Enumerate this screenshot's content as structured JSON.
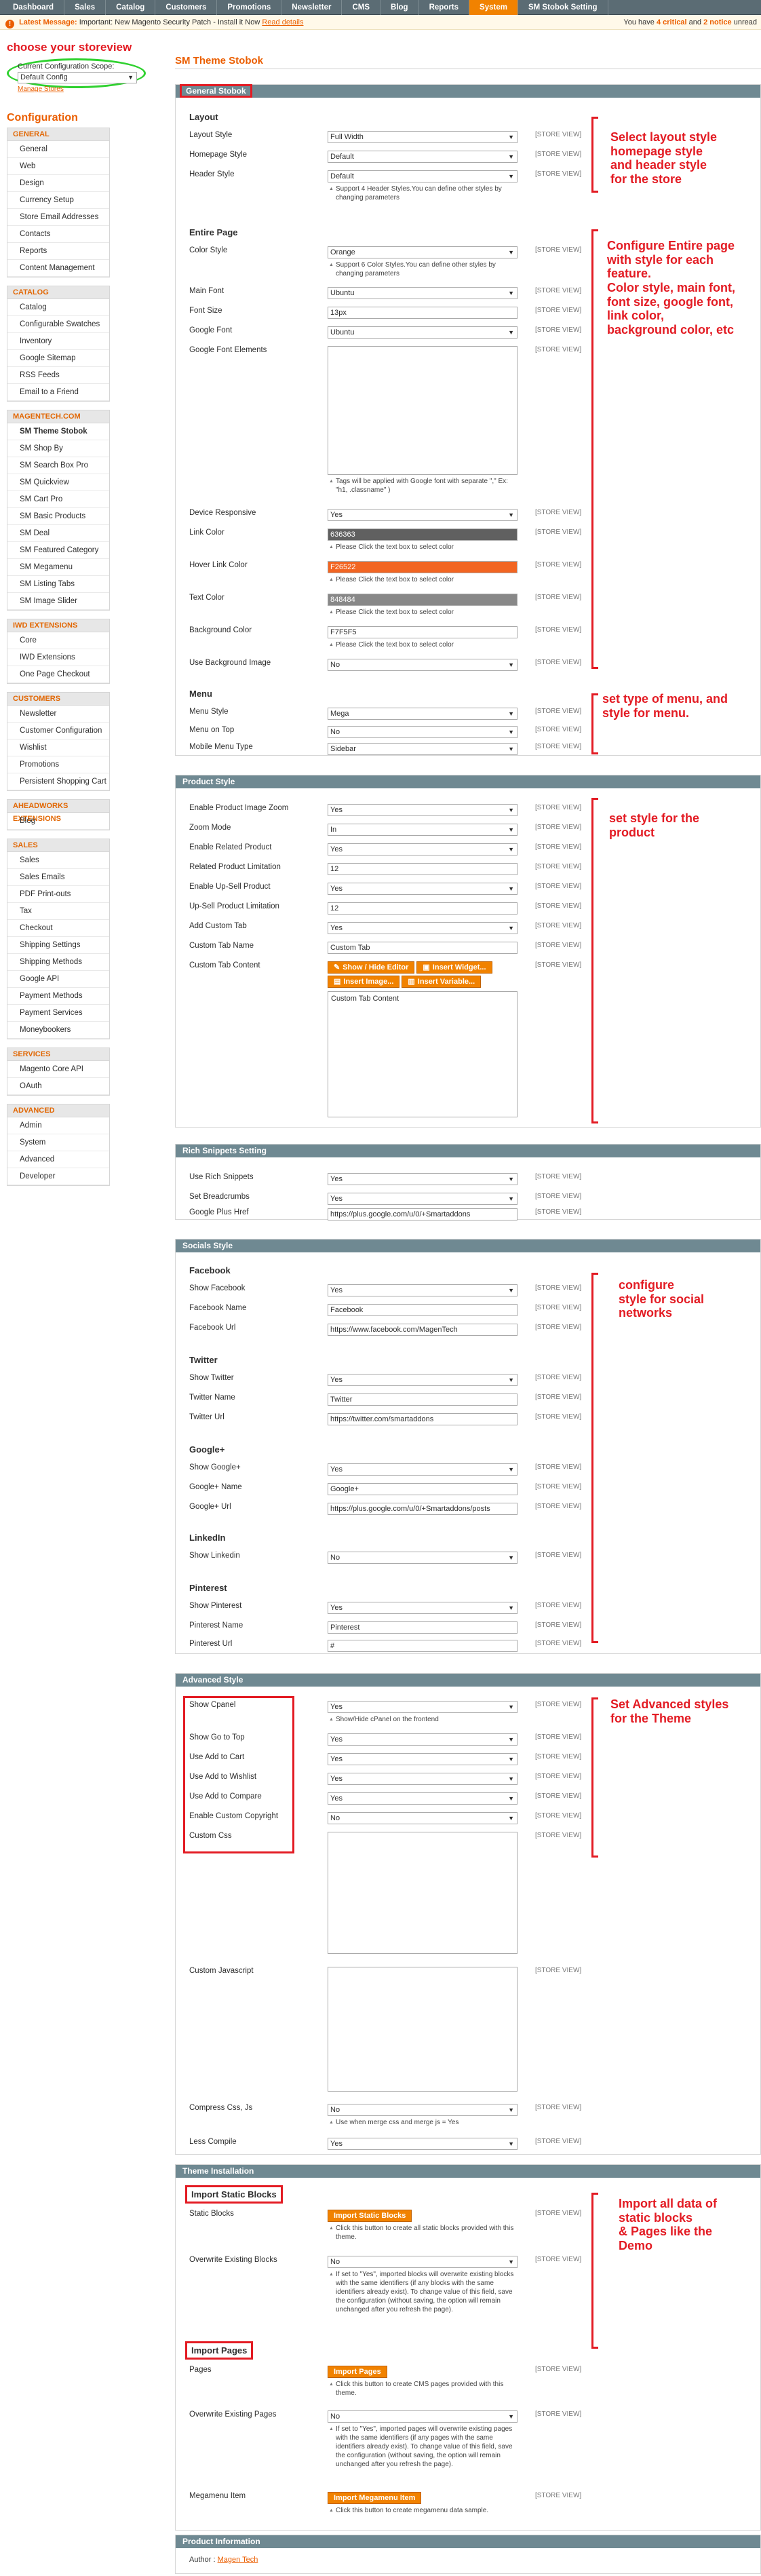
{
  "nav": [
    "Dashboard",
    "Sales",
    "Catalog",
    "Customers",
    "Promotions",
    "Newsletter",
    "CMS",
    "Blog",
    "Reports",
    "System",
    "SM Stobok Setting"
  ],
  "nav_active": "System",
  "message": {
    "label": "Latest Message:",
    "text": "Important: New Magento Security Patch - Install it Now",
    "link": "Read details",
    "right_pre": "You have",
    "critical": "4 critical",
    "mid": "and",
    "notice": "2 notice",
    "right_post": "unread"
  },
  "annotations": {
    "scope": "choose your storeview",
    "layout": "Select layout style\nhomepage style\nand header style\nfor the store",
    "entire": "Configure Entire page\nwith style for each\nfeature.\nColor style, main font,\nfont size, google font,\nlink color,\nbackground color, etc",
    "menu": "set type of menu, and\nstyle for menu.",
    "product": "set style for the\nproduct",
    "social": "configure\nstyle for social\nnetworks",
    "advanced": "Set Advanced styles\nfor the Theme",
    "install": "Import all data of\nstatic blocks\n& Pages like the\nDemo"
  },
  "scope": {
    "label": "Current Configuration Scope:",
    "value": "Default Config",
    "manage": "Manage Stores"
  },
  "sidebar_title": "Configuration",
  "groups": [
    {
      "title": "General",
      "items": [
        "General",
        "Web",
        "Design",
        "Currency Setup",
        "Store Email Addresses",
        "Contacts",
        "Reports",
        "Content Management"
      ]
    },
    {
      "title": "Catalog",
      "items": [
        "Catalog",
        "Configurable Swatches",
        "Inventory",
        "Google Sitemap",
        "RSS Feeds",
        "Email to a Friend"
      ]
    },
    {
      "title": "Magentech.com",
      "items": [
        "SM Theme Stobok",
        "SM Shop By",
        "SM Search Box Pro",
        "SM Quickview",
        "SM Cart Pro",
        "SM Basic Products",
        "SM Deal",
        "SM Featured Category",
        "SM Megamenu",
        "SM Listing Tabs",
        "SM Image Slider"
      ]
    },
    {
      "title": "IWD Extensions",
      "items": [
        "Core",
        "IWD Extensions",
        "One Page Checkout"
      ]
    },
    {
      "title": "Customers",
      "items": [
        "Newsletter",
        "Customer Configuration",
        "Wishlist",
        "Promotions",
        "Persistent Shopping Cart"
      ]
    },
    {
      "title": "Aheadworks Extensions",
      "items": [
        "Blog"
      ]
    },
    {
      "title": "Sales",
      "items": [
        "Sales",
        "Sales Emails",
        "PDF Print-outs",
        "Tax",
        "Checkout",
        "Shipping Settings",
        "Shipping Methods",
        "Google API",
        "Payment Methods",
        "Payment Services",
        "Moneybookers"
      ]
    },
    {
      "title": "Services",
      "items": [
        "Magento Core API",
        "OAuth"
      ]
    },
    {
      "title": "Advanced",
      "items": [
        "Admin",
        "System",
        "Advanced",
        "Developer"
      ]
    }
  ],
  "page_title": "SM Theme Stobok",
  "store_view": "[STORE VIEW]",
  "sections": {
    "general": "General Stobok",
    "product": "Product Style",
    "rich": "Rich Snippets Setting",
    "socials": "Socials Style",
    "advanced": "Advanced Style",
    "install": "Theme Installation",
    "info": "Product Information"
  },
  "sub": {
    "layout": "Layout",
    "entire": "Entire Page",
    "menu": "Menu",
    "facebook": "Facebook",
    "twitter": "Twitter",
    "google": "Google+",
    "linkedin": "LinkedIn",
    "pinterest": "Pinterest",
    "static": "Import Static Blocks",
    "pages": "Import Pages"
  },
  "fields": {
    "layout_style": {
      "label": "Layout Style",
      "value": "Full Width"
    },
    "homepage_style": {
      "label": "Homepage Style",
      "value": "Default"
    },
    "header_style": {
      "label": "Header Style",
      "value": "Default",
      "note": "Support 4 Header Styles.You can define other styles by changing parameters"
    },
    "color_style": {
      "label": "Color Style",
      "value": "Orange",
      "note": "Support 6 Color Styles.You can define other styles by changing parameters"
    },
    "main_font": {
      "label": "Main Font",
      "value": "Ubuntu"
    },
    "font_size": {
      "label": "Font Size",
      "value": "13px"
    },
    "google_font": {
      "label": "Google Font",
      "value": "Ubuntu"
    },
    "google_font_el": {
      "label": "Google Font Elements",
      "value": "",
      "note": "Tags will be applied with Google font with separate \",\" Ex: \"h1, .classname\" )"
    },
    "device_resp": {
      "label": "Device Responsive",
      "value": "Yes"
    },
    "link_color": {
      "label": "Link Color",
      "value": "636363",
      "note": "Please Click the text box to select color"
    },
    "hover_link": {
      "label": "Hover Link Color",
      "value": "F26522",
      "note": "Please Click the text box to select color"
    },
    "text_color": {
      "label": "Text Color",
      "value": "848484",
      "note": "Please Click the text box to select color"
    },
    "bg_color": {
      "label": "Background Color",
      "value": "F7F5F5",
      "note": "Please Click the text box to select color"
    },
    "use_bg_image": {
      "label": "Use Background Image",
      "value": "No"
    },
    "menu_style": {
      "label": "Menu Style",
      "value": "Mega"
    },
    "menu_top": {
      "label": "Menu on Top",
      "value": "No"
    },
    "mobile_menu": {
      "label": "Mobile Menu Type",
      "value": "Sidebar"
    },
    "zoom_img": {
      "label": "Enable Product Image Zoom",
      "value": "Yes"
    },
    "zoom_mode": {
      "label": "Zoom Mode",
      "value": "In"
    },
    "related": {
      "label": "Enable Related Product",
      "value": "Yes"
    },
    "related_lim": {
      "label": "Related Product Limitation",
      "value": "12"
    },
    "upsell": {
      "label": "Enable Up-Sell Product",
      "value": "Yes"
    },
    "upsell_lim": {
      "label": "Up-Sell Product Limitation",
      "value": "12"
    },
    "custom_tab": {
      "label": "Add Custom Tab",
      "value": "Yes"
    },
    "custom_tab_name": {
      "label": "Custom Tab Name",
      "value": "Custom Tab"
    },
    "custom_tab_content": {
      "label": "Custom Tab Content",
      "value": "Custom Tab Content"
    },
    "rich_snip": {
      "label": "Use Rich Snippets",
      "value": "Yes"
    },
    "breadcrumbs": {
      "label": "Set Breadcrumbs",
      "value": "Yes"
    },
    "gplus_href": {
      "label": "Google Plus Href",
      "value": "https://plus.google.com/u/0/+Smartaddons"
    },
    "show_fb": {
      "label": "Show Facebook",
      "value": "Yes"
    },
    "fb_name": {
      "label": "Facebook Name",
      "value": "Facebook"
    },
    "fb_url": {
      "label": "Facebook Url",
      "value": "https://www.facebook.com/MagenTech"
    },
    "show_tw": {
      "label": "Show Twitter",
      "value": "Yes"
    },
    "tw_name": {
      "label": "Twitter Name",
      "value": "Twitter"
    },
    "tw_url": {
      "label": "Twitter Url",
      "value": "https://twitter.com/smartaddons"
    },
    "show_gp": {
      "label": "Show Google+",
      "value": "Yes"
    },
    "gp_name": {
      "label": "Google+ Name",
      "value": "Google+"
    },
    "gp_url": {
      "label": "Google+ Url",
      "value": "https://plus.google.com/u/0/+Smartaddons/posts"
    },
    "show_li": {
      "label": "Show Linkedin",
      "value": "No"
    },
    "show_pi": {
      "label": "Show Pinterest",
      "value": "Yes"
    },
    "pi_name": {
      "label": "Pinterest Name",
      "value": "Pinterest"
    },
    "pi_url": {
      "label": "Pinterest Url",
      "value": "#"
    },
    "show_cpanel": {
      "label": "Show Cpanel",
      "value": "Yes",
      "note": "Show/Hide cPanel on the frontend"
    },
    "show_gotop": {
      "label": "Show Go to Top",
      "value": "Yes"
    },
    "add_cart": {
      "label": "Use Add to Cart",
      "value": "Yes"
    },
    "add_wish": {
      "label": "Use Add to Wishlist",
      "value": "Yes"
    },
    "add_compare": {
      "label": "Use Add to Compare",
      "value": "Yes"
    },
    "copyright": {
      "label": "Enable Custom Copyright",
      "value": "No"
    },
    "custom_css": {
      "label": "Custom Css",
      "value": ""
    },
    "custom_js": {
      "label": "Custom Javascript",
      "value": ""
    },
    "compress": {
      "label": "Compress Css, Js",
      "value": "No",
      "note": "Use when merge css and merge js = Yes"
    },
    "less": {
      "label": "Less Compile",
      "value": "Yes"
    },
    "static_blocks": {
      "label": "Static Blocks",
      "button": "Import Static Blocks",
      "note": "Click this button to create all static blocks provided with this theme."
    },
    "ow_blocks": {
      "label": "Overwrite Existing Blocks",
      "value": "No",
      "note": "If set to \"Yes\", imported blocks will overwrite existing blocks with the same identifiers (if any blocks with the same identifiers already exist). To change value of this field, save the configuration (without saving, the option will remain unchanged after you refresh the page)."
    },
    "pages": {
      "label": "Pages",
      "button": "Import Pages",
      "note": "Click this button to create CMS pages provided with this theme."
    },
    "ow_pages": {
      "label": "Overwrite Existing Pages",
      "value": "No",
      "note": "If set to \"Yes\", imported pages will overwrite existing pages with the same identifiers (if any pages with the same identifiers already exist). To change value of this field, save the configuration (without saving, the option will remain unchanged after you refresh the page)."
    },
    "megamenu": {
      "label": "Megamenu Item",
      "button": "Import Megamenu Item",
      "note": "Click this button to create megamenu data sample."
    }
  },
  "editor_buttons": [
    "Show / Hide Editor",
    "Insert Widget...",
    "Insert Image...",
    "Insert Variable..."
  ],
  "author": {
    "label": "Author :",
    "value": "Magen Tech"
  }
}
